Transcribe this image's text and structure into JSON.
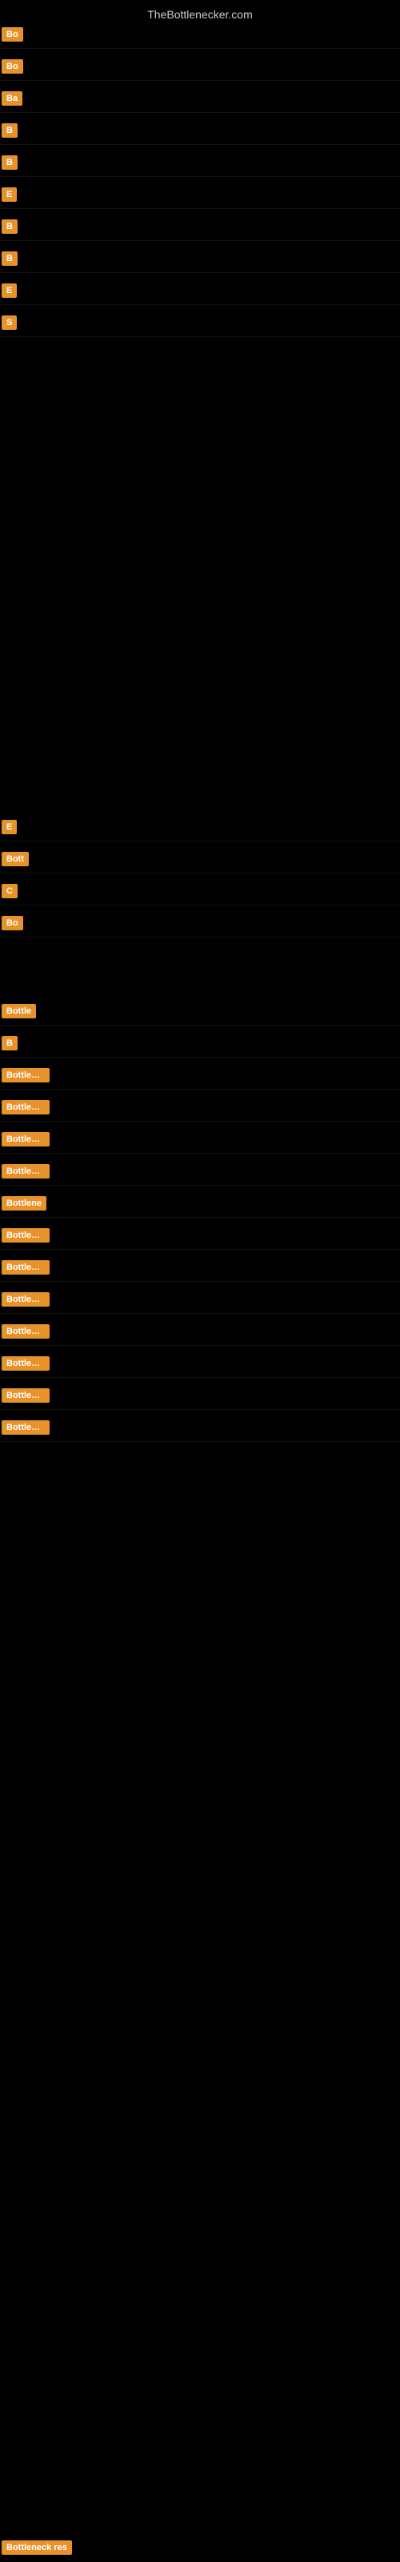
{
  "site": {
    "title": "TheBottlenecker.com"
  },
  "rows": [
    {
      "btn": "Bo",
      "text": ""
    },
    {
      "btn": "Bo",
      "text": ""
    },
    {
      "btn": "Ba",
      "text": ""
    },
    {
      "btn": "B",
      "text": ""
    },
    {
      "btn": "B",
      "text": ""
    },
    {
      "btn": "E",
      "text": ""
    },
    {
      "btn": "B",
      "text": ""
    },
    {
      "btn": "B",
      "text": ""
    },
    {
      "btn": "E",
      "text": ""
    },
    {
      "btn": "S",
      "text": ""
    }
  ],
  "lower_rows": [
    {
      "btn": "E",
      "text": ""
    },
    {
      "btn": "Bott",
      "text": ""
    },
    {
      "btn": "C",
      "text": ""
    },
    {
      "btn": "Bo",
      "text": ""
    }
  ],
  "bottom_rows": [
    {
      "btn": "Bottle",
      "text": ""
    },
    {
      "btn": "B",
      "text": ""
    },
    {
      "btn": "Bottlenec",
      "text": ""
    },
    {
      "btn": "Bottleneck",
      "text": ""
    },
    {
      "btn": "Bottleneck re",
      "text": ""
    },
    {
      "btn": "Bottleneck d",
      "text": ""
    },
    {
      "btn": "Bottlene",
      "text": ""
    },
    {
      "btn": "Bottleneck re",
      "text": ""
    },
    {
      "btn": "Bottleneck resu",
      "text": ""
    },
    {
      "btn": "Bottleneck resu",
      "text": ""
    },
    {
      "btn": "Bottleneck resu",
      "text": ""
    },
    {
      "btn": "Bottleneck resu",
      "text": ""
    },
    {
      "btn": "Bottleneck resu",
      "text": ""
    },
    {
      "btn": "Bottleneck re",
      "text": ""
    }
  ]
}
